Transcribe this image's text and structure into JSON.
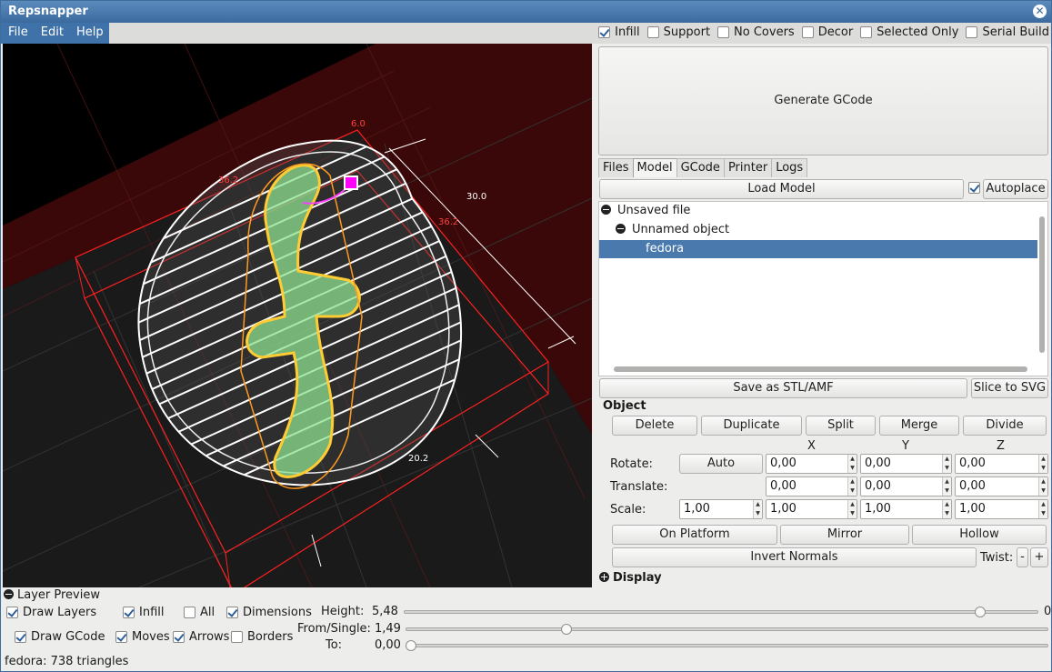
{
  "app": {
    "title": "Repsnapper"
  },
  "menu": [
    "File",
    "Edit",
    "Help"
  ],
  "toolbar_checks": [
    {
      "label": "Infill",
      "checked": true
    },
    {
      "label": "Support",
      "checked": false
    },
    {
      "label": "No Covers",
      "checked": false
    },
    {
      "label": "Decor",
      "checked": false
    },
    {
      "label": "Selected Only",
      "checked": false
    },
    {
      "label": "Serial Build",
      "checked": false
    }
  ],
  "viewport": {
    "dim_labels": [
      "6.0",
      "36.2",
      "30.0",
      "36.2",
      "20.2"
    ],
    "colors": {
      "platform": "#3a0808",
      "bbox": "#ff2020",
      "infill": "#ffffff",
      "model_fill": "#8fe08f",
      "marker": "#ff00ff"
    }
  },
  "right": {
    "generate_label": "Generate GCode",
    "tabs": [
      "Files",
      "Model",
      "GCode",
      "Printer",
      "Logs"
    ],
    "active_tab": "Model",
    "load_model_label": "Load Model",
    "autoplace": {
      "label": "Autoplace",
      "checked": true
    },
    "tree": {
      "file": "Unsaved file",
      "object": "Unnamed object",
      "shape": "fedora"
    },
    "save_label": "Save as STL/AMF",
    "slice_svg_label": "Slice to SVG",
    "object_section": "Object",
    "object_buttons": [
      "Delete",
      "Duplicate",
      "Split",
      "Merge",
      "Divide"
    ],
    "axes": [
      "X",
      "Y",
      "Z"
    ],
    "rotate_label": "Rotate:",
    "auto_label": "Auto",
    "rotate": [
      "0,00",
      "0,00",
      "0,00"
    ],
    "translate_label": "Translate:",
    "translate": [
      "0,00",
      "0,00",
      "0,00"
    ],
    "scale_label": "Scale:",
    "scale_all": "1,00",
    "scale": [
      "1,00",
      "1,00",
      "1,00"
    ],
    "on_platform_label": "On Platform",
    "mirror_label": "Mirror",
    "hollow_label": "Hollow",
    "invert_normals_label": "Invert Normals",
    "twist_label": "Twist:",
    "twist_minus": "-",
    "twist_plus": "+",
    "display_label": "Display"
  },
  "layer_preview": {
    "header": "Layer Preview",
    "draw_layers": {
      "label": "Draw Layers",
      "checked": true
    },
    "infill": {
      "label": "Infill",
      "checked": true
    },
    "all": {
      "label": "All",
      "checked": false
    },
    "dimensions": {
      "label": "Dimensions",
      "checked": true
    },
    "draw_gcode": {
      "label": "Draw GCode",
      "checked": true
    },
    "moves": {
      "label": "Moves",
      "checked": true
    },
    "arrows": {
      "label": "Arrows",
      "checked": true
    },
    "borders": {
      "label": "Borders",
      "checked": false
    },
    "height": {
      "label": "Height:",
      "value": "5,48",
      "end_value": "0",
      "fraction": 0.91
    },
    "from_single": {
      "label": "From/Single:",
      "value": "1,49",
      "fraction": 0.25
    },
    "to": {
      "label": "To:",
      "value": "0,00",
      "fraction": 0.0
    }
  },
  "status": "fedora: 738 triangles"
}
